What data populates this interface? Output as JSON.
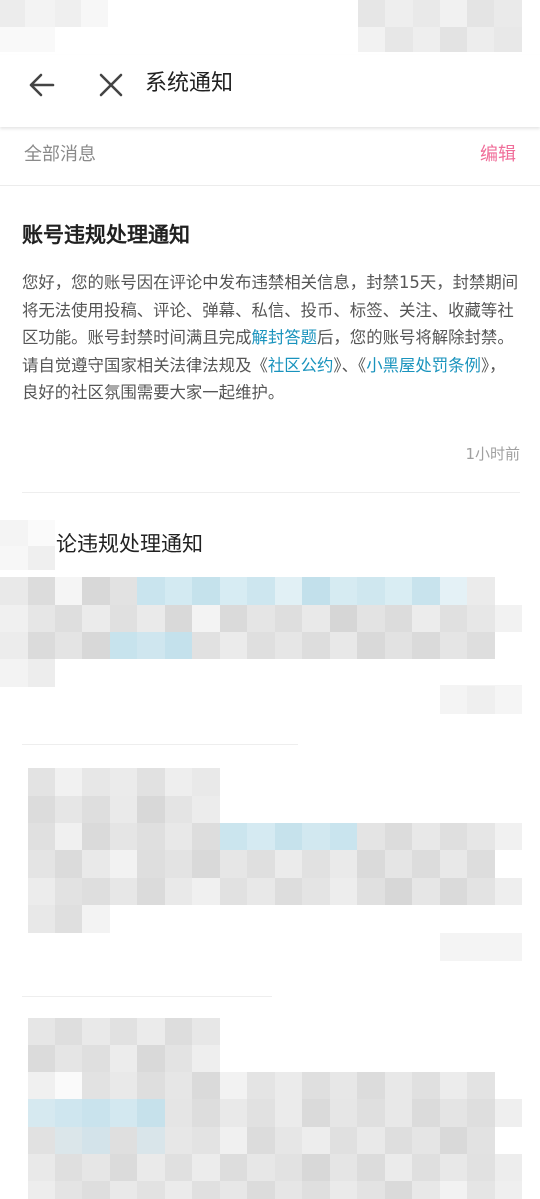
{
  "header": {
    "title": "系统通知",
    "back_icon": "arrow-left-icon",
    "close_icon": "close-icon"
  },
  "filter": {
    "label": "全部消息",
    "edit_label": "编辑",
    "edit_color": "#f06e9a"
  },
  "notices": [
    {
      "title": "账号违规处理通知",
      "body_parts": [
        "您好，您的账号因在评论中发布违禁相关信息，封禁15天，封禁期间将无法使用投稿、评论、弹幕、私信、投币、标签、关注、收藏等社区功能。账号封禁时间满且完成",
        "解封答题",
        "后，您的账号将解除封禁。请自觉遵守国家相关法律法规及《",
        "社区公约",
        "》、《",
        "小黑屋处罚条例",
        "》，良好的社区氛围需要大家一起维护。"
      ],
      "time": "1小时前"
    },
    {
      "title": "论违规处理通知"
    }
  ],
  "colors": {
    "link": "#1993bd",
    "accent": "#f06e9a"
  }
}
